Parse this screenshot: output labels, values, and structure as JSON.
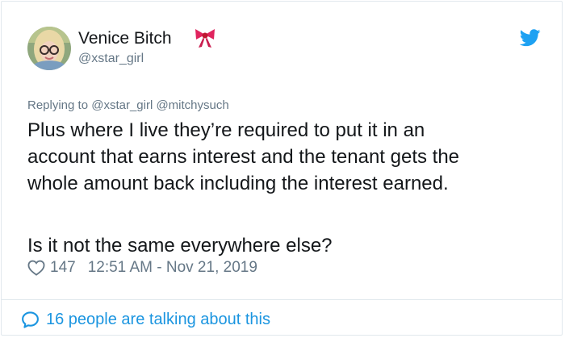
{
  "author": {
    "display_name": "Venice Bitch",
    "display_emoji": "bow-emoji",
    "handle": "@xstar_girl"
  },
  "brand": {
    "icon": "twitter-bird-icon",
    "color": "#1da1f2"
  },
  "tweet": {
    "reply_to": "Replying to @xstar_girl @mitchysuch",
    "lines": [
      "Plus where I live they’re required to put it in an",
      "account that earns interest and the tenant gets the",
      "whole amount back including the interest earned."
    ],
    "question": "Is it not the same everywhere else?",
    "like_count": "147",
    "timestamp": "12:51 AM - Nov 21, 2019"
  },
  "footer": {
    "talking_label": "16 people are talking about this",
    "link_color": "#1b95e0"
  },
  "colors": {
    "text": "#14171a",
    "secondary": "#657786",
    "border": "#e1e8ed"
  }
}
